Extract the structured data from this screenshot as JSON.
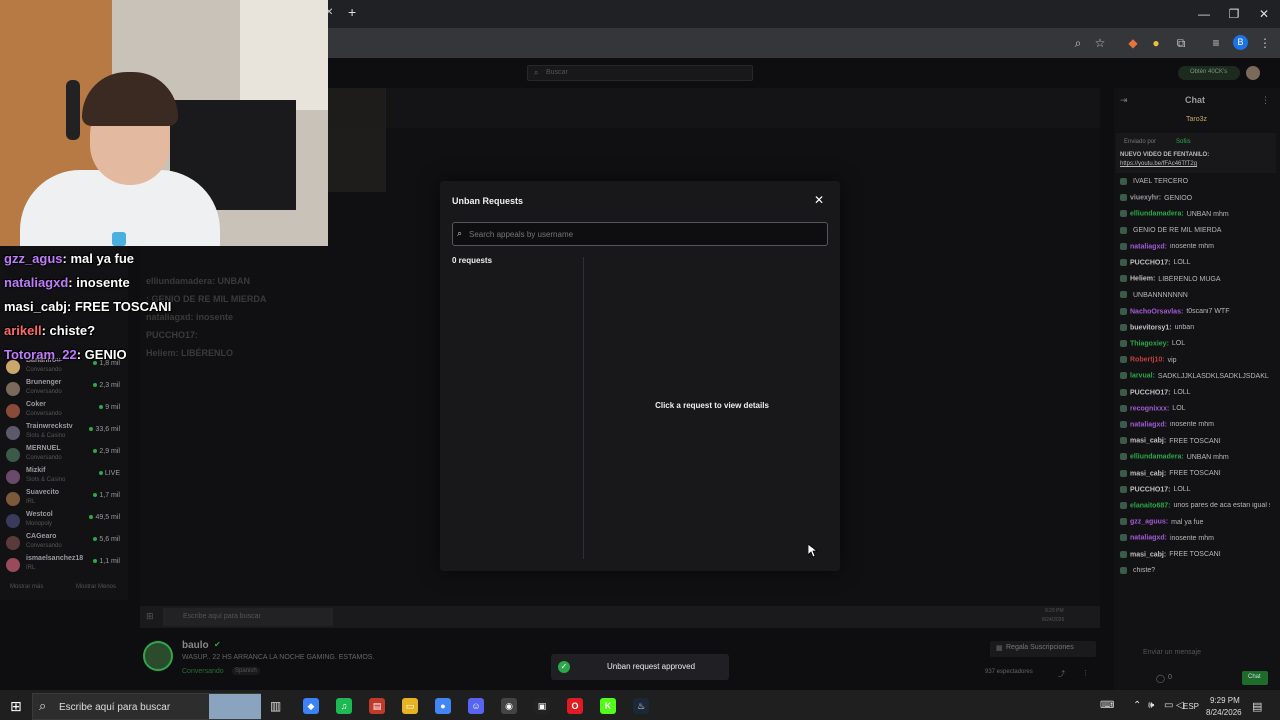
{
  "browser": {
    "new_tab": "+",
    "profile_initial": "B"
  },
  "stream_page": {
    "search_placeholder": "Buscar",
    "earn_label": "Obtén 40CK's",
    "chat_header": "Chat",
    "chat_pinned_user": "Taro3z",
    "pinned_by": "Enviado por",
    "pinned_by_user": "Sofiis",
    "pinned_text": "NUEVO VIDEO DE FENTANILO:",
    "pinned_link": "https://youtu.be/fFAc46TfT2g",
    "streamer_name": "baulo",
    "stream_title": "WASUP.. 22 HS ARRANCA LA NOCHE GAMING. ESTAMOS.",
    "stream_category": "Conversando",
    "stream_language": "Spanish",
    "subs_button": "Regala Suscripciones",
    "viewers": "937 espectadores",
    "chat_button": "Chat",
    "chat_input_placeholder": "Enviar un mensaje",
    "chat_points": "0",
    "show_more": "Mostrar más",
    "show_less": "Mostrar Menos",
    "channels": [
      {
        "name": "Bananirou",
        "cat": "Conversando",
        "viewers": "1,8 mil",
        "color": "#c9a86a"
      },
      {
        "name": "Brunenger",
        "cat": "Conversando",
        "viewers": "2,3 mil",
        "color": "#7a6a5a"
      },
      {
        "name": "Coker",
        "cat": "Conversando",
        "viewers": "9 mil",
        "color": "#8a4a3a"
      },
      {
        "name": "Trainwreckstv",
        "cat": "Slots & Casino",
        "viewers": "33,6 mil",
        "color": "#5a5a6a"
      },
      {
        "name": "MERNUEL",
        "cat": "Conversando",
        "viewers": "2,9 mil",
        "color": "#3a5a4a"
      },
      {
        "name": "Mizkif",
        "cat": "Slots & Casino",
        "viewers": "LIVE",
        "color": "#6a4a6a"
      },
      {
        "name": "Suavecito",
        "cat": "IRL",
        "viewers": "1,7 mil",
        "color": "#7a5a3a"
      },
      {
        "name": "Westcol",
        "cat": "Monopoly",
        "viewers": "49,5 mil",
        "color": "#3a3a5a"
      },
      {
        "name": "CAGearo",
        "cat": "Conversando",
        "viewers": "5,6 mil",
        "color": "#5a3a3a"
      },
      {
        "name": "ismaelsanchez18",
        "cat": "IRL",
        "viewers": "1,1 mil",
        "color": "#9a4a5a"
      }
    ],
    "chat_messages": [
      {
        "user": "",
        "text": "IVAEL TERCERO",
        "color": "#a35ad6"
      },
      {
        "user": "viuexyhr:",
        "text": "GENIOO",
        "color": "#9a9aa0"
      },
      {
        "user": "elliundamadera:",
        "text": "UNBAN mhm",
        "color": "#2ba84a"
      },
      {
        "user": "",
        "text": "GENIO DE RE MIL MIERDA",
        "color": "#c04040"
      },
      {
        "user": "nataliagxd:",
        "text": "inosente mhm",
        "color": "#a35ad6"
      },
      {
        "user": "PUCCHO17:",
        "text": "LOLL",
        "color": "#c0c0c0"
      },
      {
        "user": "Heliem:",
        "text": "LIBÉRENLO MUGA",
        "color": "#c0c0c0"
      },
      {
        "user": "",
        "text": "UNBANNNNNNN",
        "color": "#c04040"
      },
      {
        "user": "NachoOrsavlas:",
        "text": "t0scani7 WTF",
        "color": "#a35ad6"
      },
      {
        "user": "buevitorsy1:",
        "text": "unban",
        "color": "#c0c0c0"
      },
      {
        "user": "Thiagoxiey:",
        "text": "LOL",
        "color": "#2ba84a"
      },
      {
        "user": "Robertj10:",
        "text": "vip",
        "color": "#c04040"
      },
      {
        "user": "larvual:",
        "text": "SADKLJJKLASDKLSADKLJSDAKL",
        "color": "#2ba84a"
      },
      {
        "user": "PUCCHO17:",
        "text": "LOLL",
        "color": "#c0c0c0"
      },
      {
        "user": "recognixxx:",
        "text": "LOL",
        "color": "#a35ad6"
      },
      {
        "user": "nataliagxd:",
        "text": "inosente mhm",
        "color": "#a35ad6"
      },
      {
        "user": "masi_cabj:",
        "text": "FREE TOSCANI",
        "color": "#c0c0c0"
      },
      {
        "user": "elliundamadera:",
        "text": "UNBAN mhm",
        "color": "#2ba84a"
      },
      {
        "user": "masi_cabj:",
        "text": "FREE TOSCANI",
        "color": "#c0c0c0"
      },
      {
        "user": "PUCCHO17:",
        "text": "LOLL",
        "color": "#c0c0c0"
      },
      {
        "user": "elanaito687:",
        "text": "unos pares de aca estan igual si los revises LOL",
        "color": "#2ba84a"
      },
      {
        "user": "gzz_aguus:",
        "text": "mal ya fue",
        "color": "#a35ad6"
      },
      {
        "user": "nataliagxd:",
        "text": "inosente mhm",
        "color": "#a35ad6"
      },
      {
        "user": "masi_cabj:",
        "text": "FREE TOSCANI",
        "color": "#c0c0c0"
      },
      {
        "user": "",
        "text": "chiste?",
        "color": "#c04040"
      }
    ]
  },
  "overlay_chat": [
    {
      "user": "gzz_agus",
      "text": ": mal ya fue",
      "color": "#c27bff"
    },
    {
      "user": "nataliagxd",
      "text": ": inosente",
      "color": "#c27bff"
    },
    {
      "user": "masi_cabj",
      "text": ": FREE TOSCANI",
      "color": "#ffffff"
    },
    {
      "user": "arikell",
      "text": ": chiste?",
      "color": "#ff6a6a"
    },
    {
      "user": "Totoram_22",
      "text": ": GENIO",
      "color": "#c27bff"
    }
  ],
  "overlay_bg_chat": [
    {
      "user": "elliundamadera",
      "text": ": UNBAN"
    },
    {
      "user": "",
      "text": ": GENIO DE RE MIL MIERDA"
    },
    {
      "user": "nataliagxd",
      "text": ": inosente"
    },
    {
      "user": "PUCCHO17",
      "text": ":"
    },
    {
      "user": "Heliem",
      "text": ": LIBÉRENLO"
    }
  ],
  "modal": {
    "title": "Unban Requests",
    "search_placeholder": "Search appeals by username",
    "count": "0 requests",
    "empty_detail": "Click a request to view details"
  },
  "toast": {
    "message": "Unban request approved"
  },
  "inner_taskbar": {
    "search_placeholder": "Escribe aquí para buscar",
    "time": "9:29 PM",
    "date": "8/24/2026"
  },
  "taskbar": {
    "search_placeholder": "Escribe aquí para buscar",
    "language": "ESP",
    "time": "9:29 PM",
    "date": "8/24/2026",
    "apps": [
      {
        "name": "copilot-icon",
        "color": "#3b82f6",
        "glyph": "◆"
      },
      {
        "name": "spotify-icon",
        "color": "#1db954",
        "glyph": "♫"
      },
      {
        "name": "voice-mixer-icon",
        "color": "#c0392b",
        "glyph": "▤"
      },
      {
        "name": "file-explorer-icon",
        "color": "#e6b422",
        "glyph": "▭"
      },
      {
        "name": "chrome-icon",
        "color": "#4285f4",
        "glyph": "●"
      },
      {
        "name": "discord-icon",
        "color": "#5865f2",
        "glyph": "☺"
      },
      {
        "name": "obs-icon",
        "color": "#444444",
        "glyph": "◉"
      },
      {
        "name": "capcut-icon",
        "color": "#222222",
        "glyph": "▣"
      },
      {
        "name": "opera-icon",
        "color": "#e01b24",
        "glyph": "O"
      },
      {
        "name": "kick-icon",
        "color": "#53fc18",
        "glyph": "K"
      },
      {
        "name": "steam-icon",
        "color": "#1b2838",
        "glyph": "♨"
      }
    ]
  }
}
